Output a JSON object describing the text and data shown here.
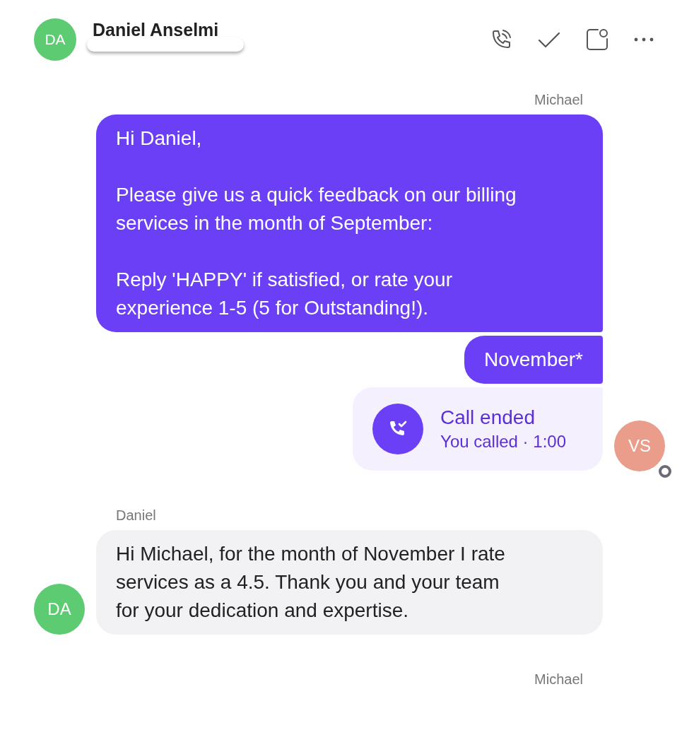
{
  "header": {
    "avatar": {
      "initials": "DA",
      "color": "#5ccb72"
    },
    "name": "Daniel Anselmi"
  },
  "groups": [
    {
      "kind": "outgoing",
      "sender": "Michael",
      "avatar": {
        "initials": "VS",
        "color": "#e99d8a",
        "status_ring": true
      },
      "messages": [
        {
          "kind": "text",
          "text": "Hi Daniel,\n\nPlease give us a quick feedback on our billing services in the month of September:\n\nReply 'HAPPY' if satisfied, or rate your experience 1-5 (5 for Outstanding!)."
        },
        {
          "kind": "text",
          "text": "November*"
        },
        {
          "kind": "call",
          "title": "Call ended",
          "detail": "You called · 1:00"
        }
      ]
    },
    {
      "kind": "incoming",
      "sender": "Daniel",
      "avatar": {
        "initials": "DA",
        "color": "#5ccb72"
      },
      "messages": [
        {
          "kind": "text",
          "text": "Hi Michael, for the month of November I rate services as a 4.5.  Thank you and your team for your dedication and expertise."
        }
      ]
    },
    {
      "kind": "outgoing",
      "sender": "Michael"
    }
  ]
}
